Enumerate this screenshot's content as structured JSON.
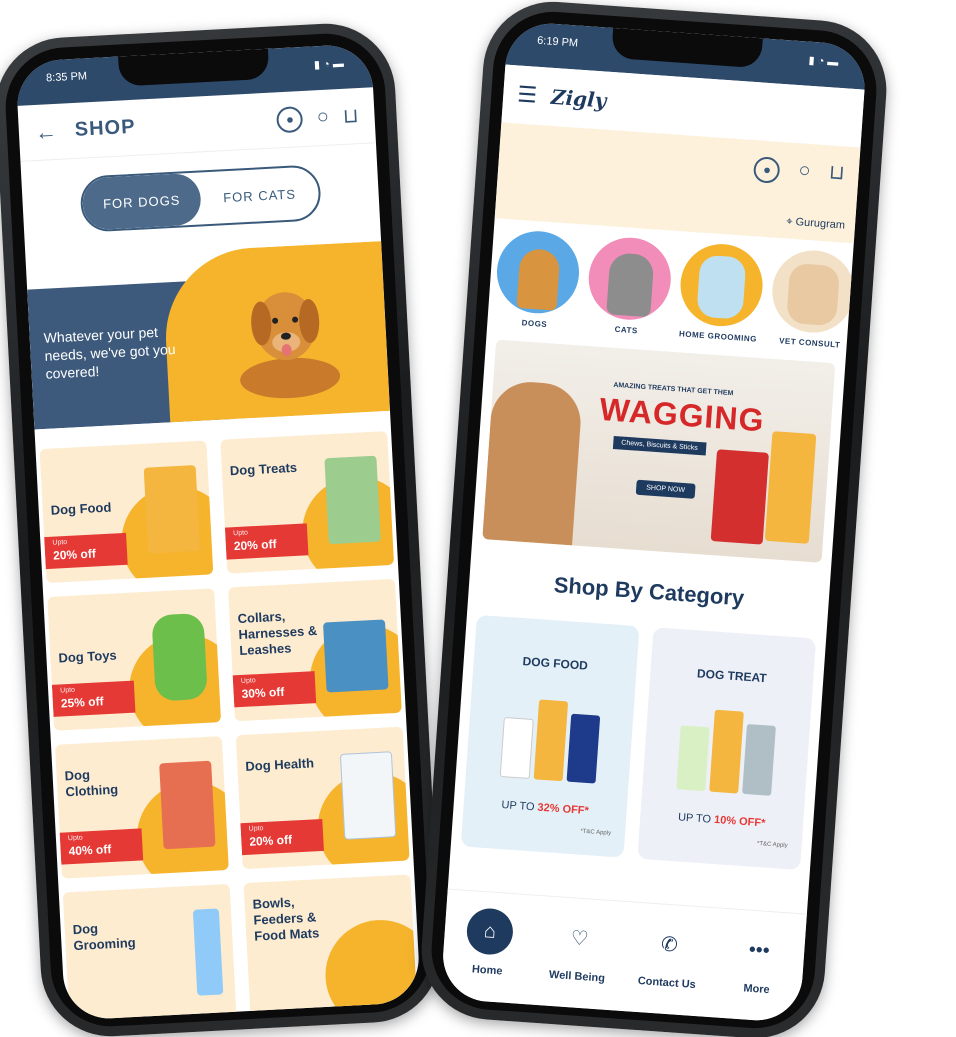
{
  "left_phone": {
    "status": {
      "time": "8:35 PM"
    },
    "header": {
      "title": "SHOP",
      "back_icon": "arrow-left-icon",
      "icons": [
        "user-icon",
        "search-icon",
        "cart-icon"
      ]
    },
    "toggle": {
      "options": [
        "FOR DOGS",
        "FOR CATS"
      ],
      "selected": "FOR DOGS"
    },
    "hero": {
      "tagline": "Whatever your pet needs, we've got you covered!"
    },
    "tiles": [
      {
        "name": "Dog Food",
        "upto": "Upto",
        "discount": "20% off"
      },
      {
        "name": "Dog Treats",
        "upto": "Upto",
        "discount": "20% off"
      },
      {
        "name": "Dog Toys",
        "upto": "Upto",
        "discount": "25% off"
      },
      {
        "name": "Collars, Harnesses & Leashes",
        "upto": "Upto",
        "discount": "30% off"
      },
      {
        "name": "Dog Clothing",
        "upto": "Upto",
        "discount": "40% off"
      },
      {
        "name": "Dog Health",
        "upto": "Upto",
        "discount": "20% off"
      },
      {
        "name": "Dog Grooming",
        "upto": "",
        "discount": ""
      },
      {
        "name": "Bowls, Feeders & Food Mats",
        "upto": "",
        "discount": ""
      }
    ]
  },
  "right_phone": {
    "status": {
      "time": "6:19 PM"
    },
    "header": {
      "logo": "Zigly",
      "menu_icon": "hamburger-icon",
      "icons": [
        "user-icon",
        "search-icon",
        "cart-icon"
      ]
    },
    "location": "Gurugram",
    "categories": [
      {
        "label": "DOGS",
        "color": "#5aa9e6"
      },
      {
        "label": "CATS",
        "color": "#f28cb8"
      },
      {
        "label": "HOME GROOMING",
        "color": "#f5b42c"
      },
      {
        "label": "VET CONSULT",
        "color": "#f3e1c7"
      }
    ],
    "banner": {
      "kicker": "AMAZING TREATS THAT GET THEM",
      "headline": "WAGGING",
      "strip": "Chews, Biscuits & Sticks",
      "cta": "SHOP NOW"
    },
    "section_title": "Shop By Category",
    "category_cards": [
      {
        "title": "DOG FOOD",
        "offer_prefix": "UP TO",
        "offer": "32% OFF*",
        "tnc": "*T&C Apply"
      },
      {
        "title": "DOG TREAT",
        "offer_prefix": "UP TO",
        "offer": "10% OFF*",
        "tnc": "*T&C Apply"
      }
    ],
    "bottom_nav": [
      {
        "label": "Home",
        "icon": "home-icon",
        "active": true
      },
      {
        "label": "Well Being",
        "icon": "heart-paw-icon",
        "active": false
      },
      {
        "label": "Contact Us",
        "icon": "phone-icon",
        "active": false
      },
      {
        "label": "More",
        "icon": "more-dots-icon",
        "active": false
      }
    ]
  }
}
